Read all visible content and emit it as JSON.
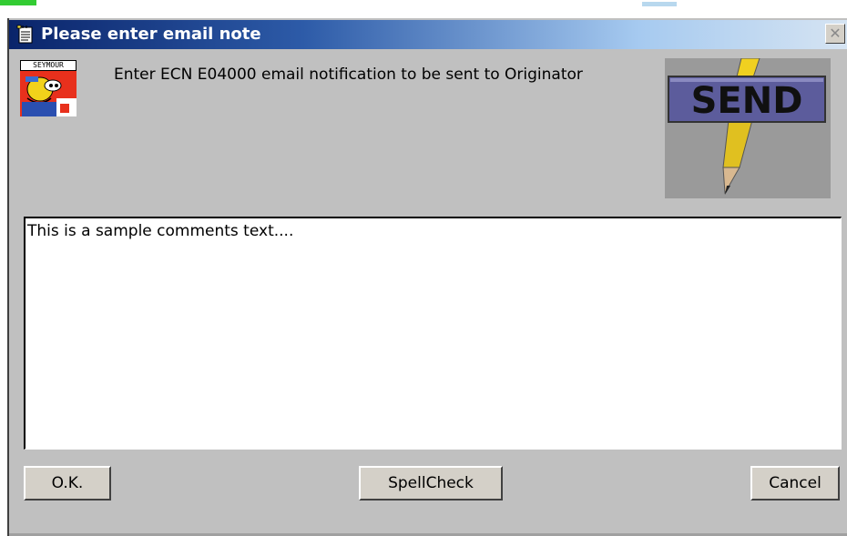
{
  "window": {
    "title": "Please enter email note",
    "close_glyph": "✕"
  },
  "avatar": {
    "label": "SEYMOUR"
  },
  "message": {
    "instruction": "Enter ECN E04000 email notification to be sent to Originator"
  },
  "send_image": {
    "label": "SEND"
  },
  "comments": {
    "value": "This is a sample comments text...."
  },
  "buttons": {
    "ok_label": "O.K.",
    "spellcheck_label": "SpellCheck",
    "cancel_label": "Cancel"
  },
  "icons": {
    "title": "notepad-icon",
    "close": "close-icon",
    "send": "pencil-icon"
  },
  "colors": {
    "dialog_bg": "#c0c0c0",
    "titlebar_start": "#0a246a",
    "titlebar_end": "#d6e4f2",
    "send_sign": "#5c5c9c",
    "avatar_bg": "#e8301c"
  }
}
